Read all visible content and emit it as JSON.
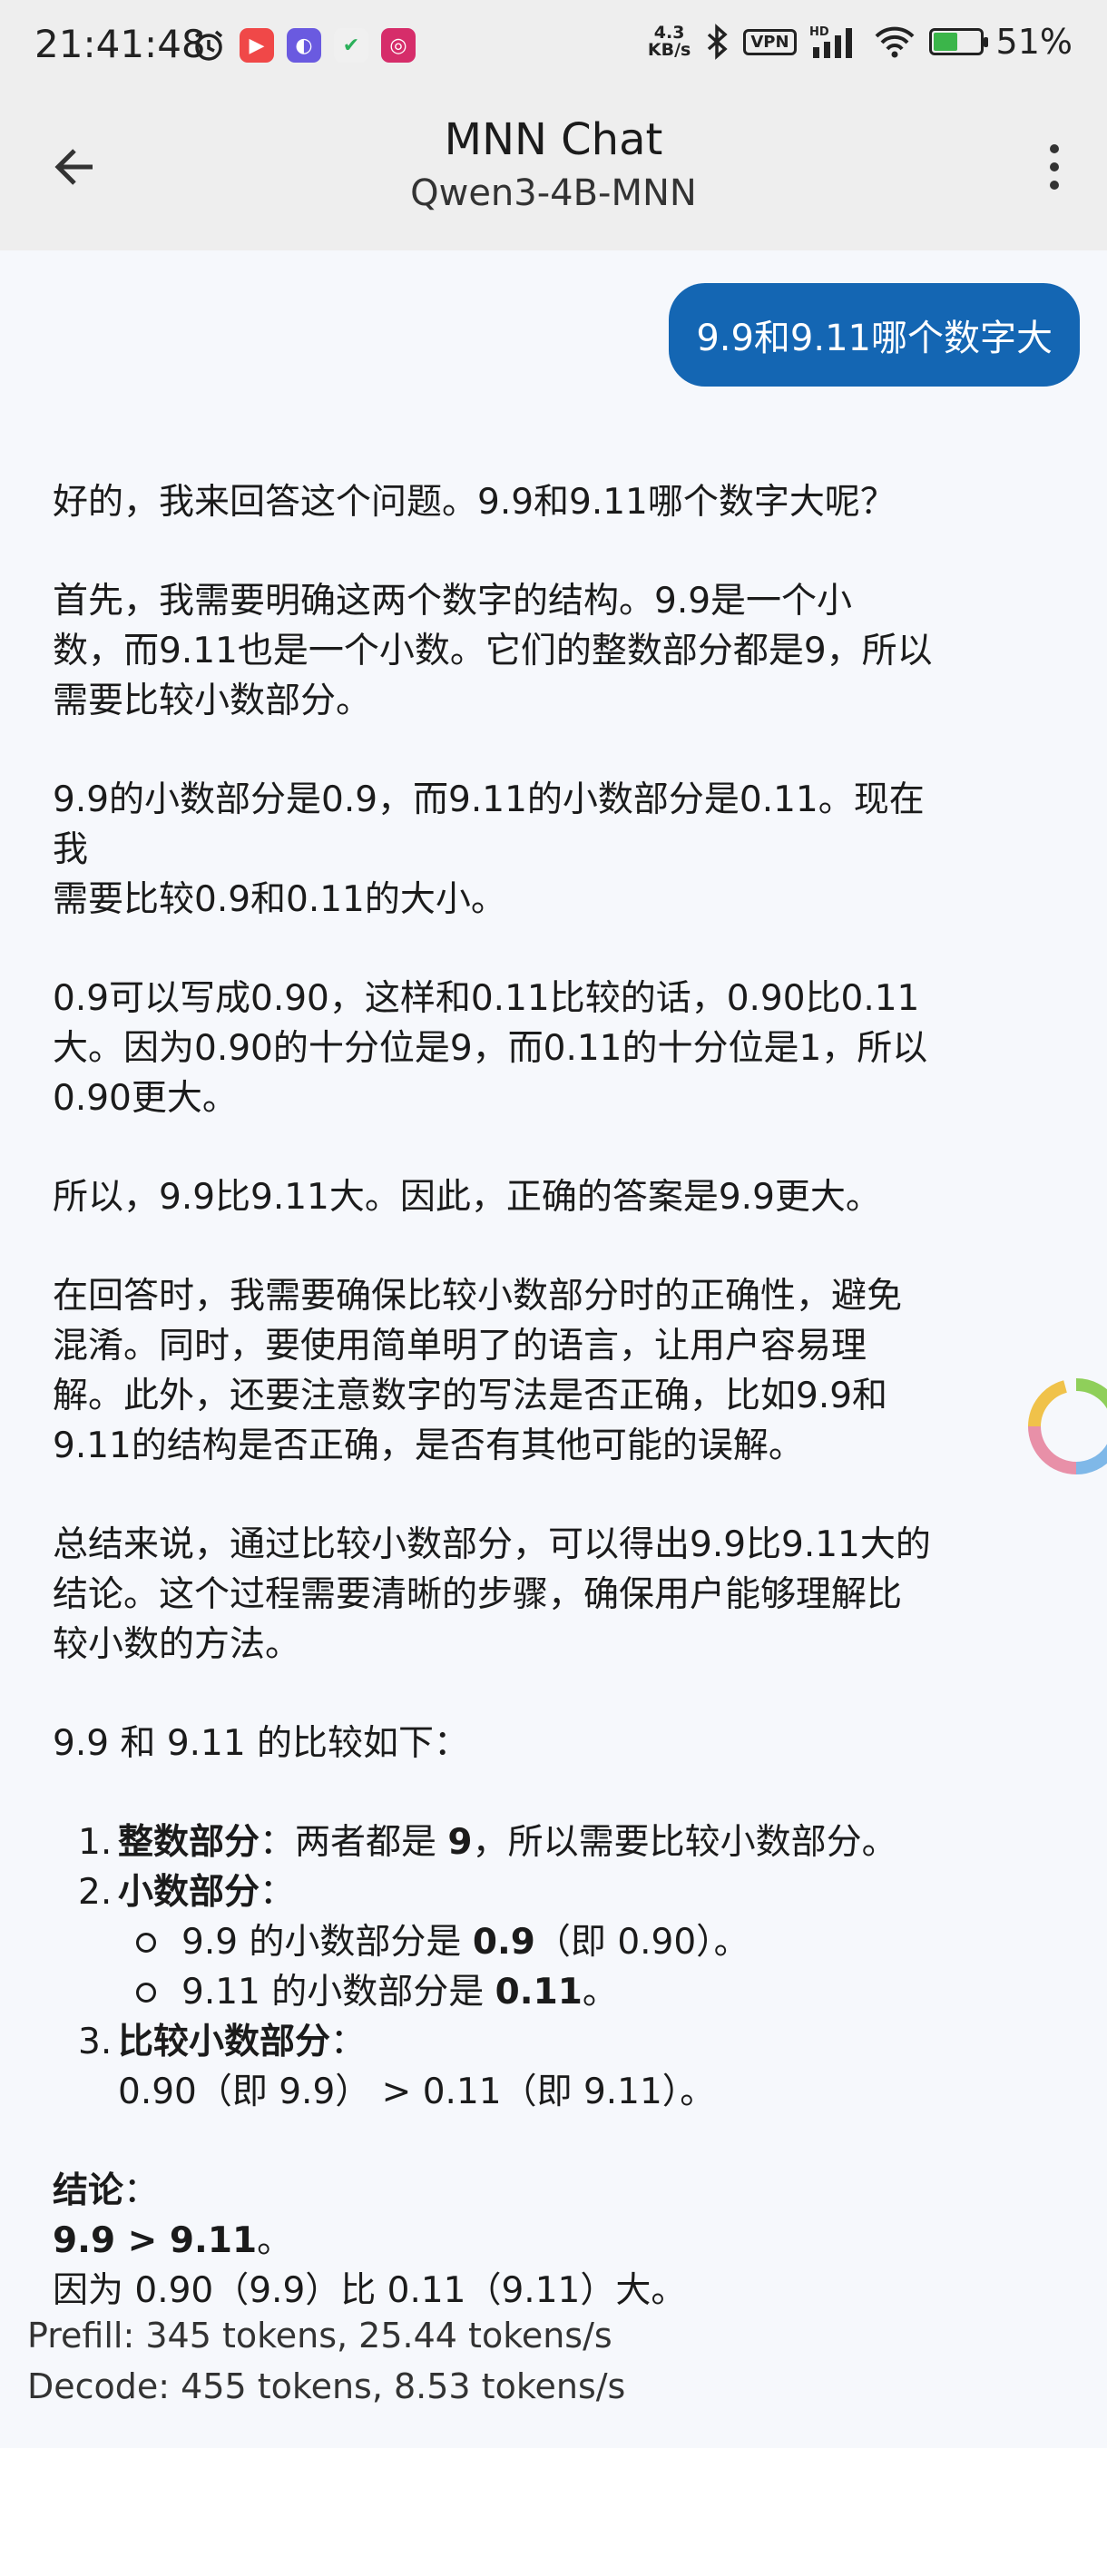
{
  "status_bar": {
    "time": "21:41:48",
    "net_speed_value": "4.3",
    "net_speed_unit": "KB/s",
    "vpn_label": "VPN",
    "signal_label": "HD",
    "battery_percent": "51%",
    "battery_level": 0.51
  },
  "header": {
    "title": "MNN Chat",
    "subtitle": "Qwen3-4B-MNN"
  },
  "chat": {
    "user_message": "9.9和9.11哪个数字大",
    "paragraphs": [
      "好的，我来回答这个问题。9.9和9.11哪个数字大呢？",
      "首先，我需要明确这两个数字的结构。9.9是一个小\n数，而9.11也是一个小数。它们的整数部分都是9，所以\n需要比较小数部分。",
      "9.9的小数部分是0.9，而9.11的小数部分是0.11。现在我\n需要比较0.9和0.11的大小。",
      "0.9可以写成0.90，这样和0.11比较的话，0.90比0.11\n大。因为0.90的十分位是9，而0.11的十分位是1，所以\n0.90更大。",
      "所以，9.9比9.11大。因此，正确的答案是9.9更大。",
      "在回答时，我需要确保比较小数部分时的正确性，避免\n混淆。同时，要使用简单明了的语言，让用户容易理\n解。此外，还要注意数字的写法是否正确，比如9.9和\n9.11的结构是否正确，是否有其他可能的误解。",
      "总结来说，通过比较小数部分，可以得出9.9比9.11大的\n结论。这个过程需要清晰的步骤，确保用户能够理解比\n较小数的方法。",
      "9.9 和 9.11 的比较如下："
    ],
    "list": {
      "item1_num": "1.",
      "item1_bold": "整数部分",
      "item1_text_a": "：两者都是 ",
      "item1_bold2": "9",
      "item1_text_b": "，所以需要比较小数部分。",
      "item2_num": "2.",
      "item2_bold": "小数部分",
      "item2_colon": "：",
      "sub1_text": "9.9 的小数部分是 ",
      "sub1_bold": "0.9",
      "sub1_tail": "（即 0.90）。",
      "sub2_text": "9.11 的小数部分是 ",
      "sub2_bold": "0.11",
      "sub2_tail": "。",
      "item3_num": "3.",
      "item3_bold": "比较小数部分",
      "item3_colon": "：",
      "item3_detail": "0.90（即 9.9） > 0.11（即 9.11）。"
    },
    "conclusion_label": "结论",
    "conclusion_colon": "：",
    "conclusion_bold": "9.9 > 9.11",
    "conclusion_period": "。",
    "conclusion_reason": "因为 0.90（9.9）比 0.11（9.11）大。",
    "prefill_stats": "Prefill: 345 tokens, 25.44 tokens/s",
    "decode_stats": "Decode: 455 tokens, 8.53 tokens/s"
  },
  "icons": {
    "back": "arrow-back-icon",
    "menu": "more-vert-icon",
    "loading": "loading-spinner-icon"
  },
  "colors": {
    "user_bubble": "#1466b3",
    "app_bar": "#eeeeee",
    "chat_background": "#f6f8fc"
  }
}
